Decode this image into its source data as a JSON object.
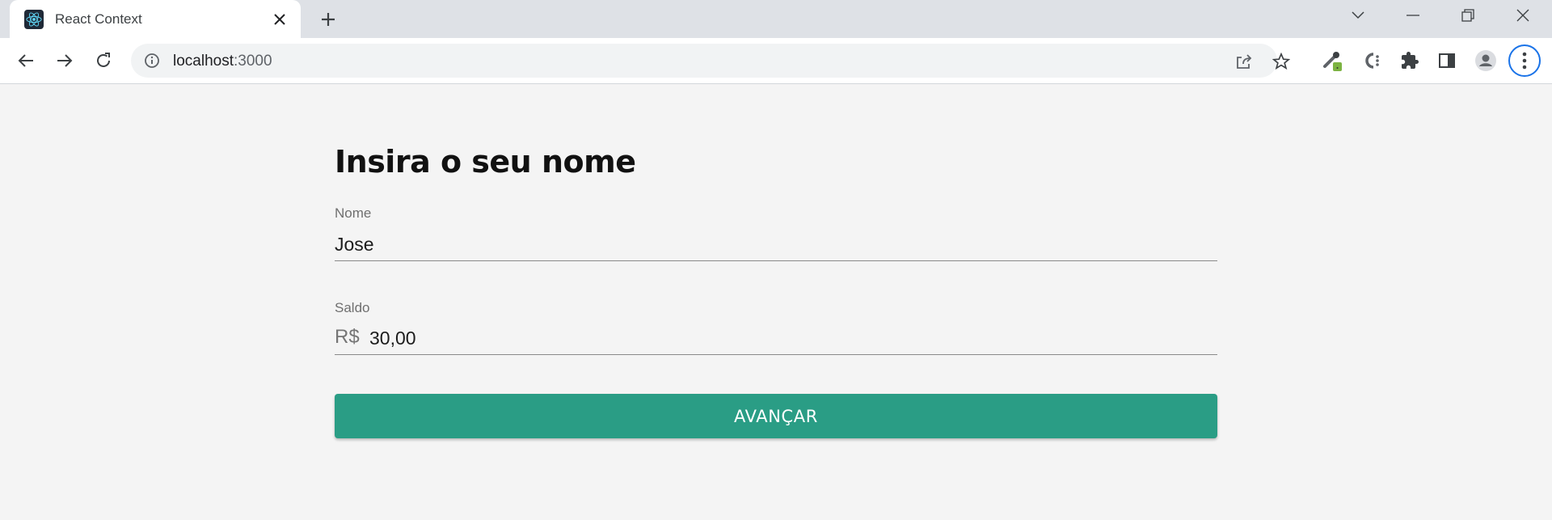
{
  "browser": {
    "tab_title": "React Context",
    "url_host": "localhost",
    "url_port": ":3000"
  },
  "icons": {
    "favicon": "react-logo-icon",
    "close": "close-icon",
    "new_tab": "plus-icon",
    "back": "arrow-left-icon",
    "forward": "arrow-right-icon",
    "reload": "reload-icon",
    "info": "info-icon",
    "share": "share-icon",
    "bookmark": "star-icon",
    "extensions": "puzzle-icon",
    "side_panel": "side-panel-icon",
    "profile": "profile-icon",
    "menu": "kebab-menu-icon"
  },
  "page": {
    "title": "Insira o seu nome",
    "name_field": {
      "label": "Nome",
      "value": "Jose"
    },
    "balance_field": {
      "label": "Saldo",
      "prefix": "R$",
      "value": "30,00"
    },
    "submit_label": "AVANÇAR"
  },
  "colors": {
    "accent": "#2a9d85",
    "page_background": "#f4f4f4"
  }
}
